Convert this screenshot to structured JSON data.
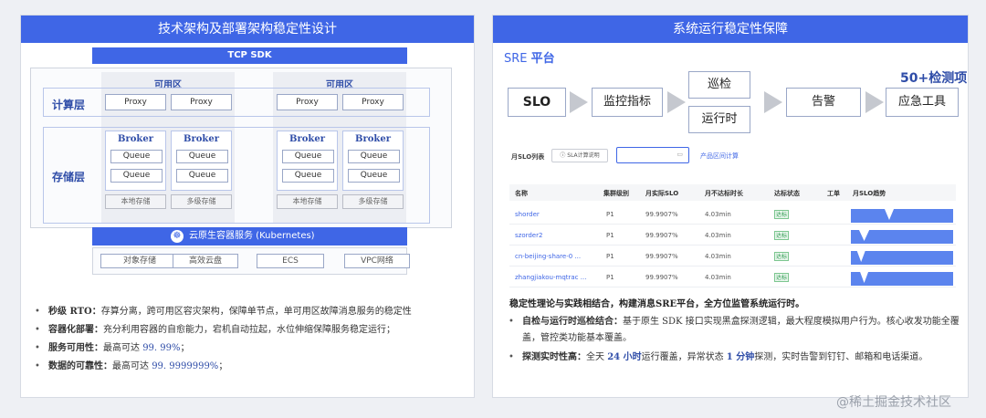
{
  "left_panel": {
    "title": "技术架构及部署架构稳定性设计",
    "sdk_bar": "TCP SDK",
    "compute_layer": "计算层",
    "storage_layer": "存储层",
    "az_label_1": "可用区",
    "az_label_2": "可用区",
    "proxy": "Proxy",
    "broker": "Broker",
    "queue": "Queue",
    "local_storage": "本地存储",
    "multi_storage": "多级存储",
    "k8s_bar": "云原生容器服务 (Kubernetes)",
    "bottom_items": [
      "对象存储",
      "高效云盘",
      "ECS",
      "VPC网络"
    ],
    "bullets": [
      {
        "head": "秒级 RTO：",
        "text": "存算分离，跨可用区容灾架构，保障单节点，单可用区故障消息服务的稳定性"
      },
      {
        "head": "容器化部署：",
        "text": "充分利用容器的自愈能力，宕机自动拉起，水位伸缩保障服务稳定运行；"
      },
      {
        "head": "服务可用性：",
        "text": "最高可达 ",
        "value": "99. 99%",
        "tail": "；"
      },
      {
        "head": "数据的可靠性：",
        "text": "最高可达 ",
        "value": "99. 9999999%",
        "tail": "；"
      }
    ]
  },
  "right_panel": {
    "title": "系统运行稳定性保障",
    "sre_label": "SRE ",
    "sre_label_bold": "平台",
    "checks_count": "50+检测项",
    "flow": {
      "slo": "SLO",
      "metrics": "监控指标",
      "inspect": "巡检",
      "runtime": "运行时",
      "alert": "告警",
      "tools": "应急工具"
    },
    "table": {
      "tab_title": "月SLO列表",
      "sla_button": "SLA计算说明",
      "date_placeholder": "",
      "range_link": "产品区间计算",
      "headers": [
        "名称",
        "集群级别",
        "月实际SLO",
        "月不达标时长",
        "达标状态",
        "工单",
        "月SLO趋势"
      ],
      "rows": [
        {
          "name": "shorder",
          "level": "P1",
          "slo": "99.9907%",
          "duration": "4.03min",
          "status": "达标"
        },
        {
          "name": "szorder2",
          "level": "P1",
          "slo": "99.9907%",
          "duration": "4.03min",
          "status": "达标"
        },
        {
          "name": "cn-beijing-share-0 ...",
          "level": "P1",
          "slo": "99.9907%",
          "duration": "4.03min",
          "status": "达标"
        },
        {
          "name": "zhangjiakou-mqtrac ...",
          "level": "P1",
          "slo": "99.9907%",
          "duration": "4.03min",
          "status": "达标"
        }
      ]
    },
    "summary": "稳定性理论与实践相结合，构建消息SRE平台，全方位监管系统运行时。",
    "bullets": [
      {
        "head": "自检与运行时巡检结合：",
        "text": "基于原生 SDK 接口实现黑盒探测逻辑，最大程度模拟用户行为。核心收发功能全覆盖，管控类功能基本覆盖。"
      },
      {
        "head": "探测实时性高：",
        "pre": "全天 ",
        "v1": "24 小时",
        "mid": "运行覆盖，异常状态 ",
        "v2": "1 分钟",
        "post": "探测，实时告警到钉钉、邮箱和电话渠道。"
      }
    ]
  },
  "watermark": "@稀土掘金技术社区",
  "colors": {
    "accent": "#3f66e6",
    "dark_blue": "#2f4da8"
  }
}
